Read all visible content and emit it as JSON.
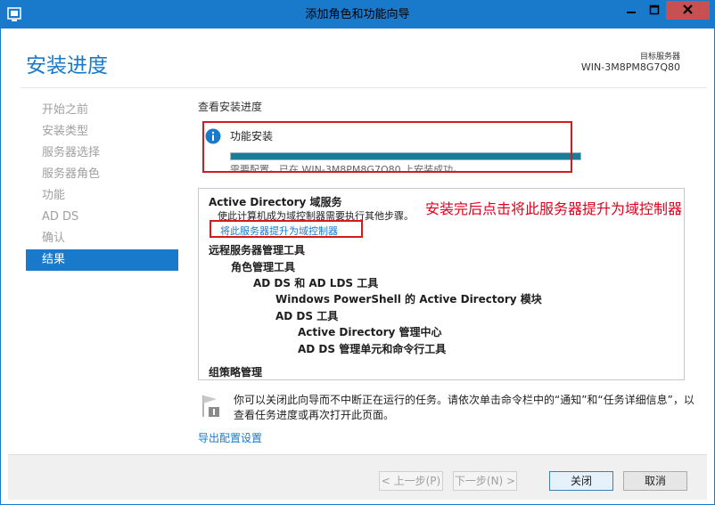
{
  "window": {
    "title": "添加角色和功能向导",
    "controls": {
      "minimize": "minimize-icon",
      "maximize": "maximize-icon",
      "close": "close-icon"
    }
  },
  "header": {
    "page_title": "安装进度",
    "target_label": "目标服务器",
    "target_name": "WIN-3M8PM8G7Q80"
  },
  "nav": {
    "items": [
      {
        "label": "开始之前",
        "active": false
      },
      {
        "label": "安装类型",
        "active": false
      },
      {
        "label": "服务器选择",
        "active": false
      },
      {
        "label": "服务器角色",
        "active": false
      },
      {
        "label": "功能",
        "active": false
      },
      {
        "label": "AD DS",
        "active": false
      },
      {
        "label": "确认",
        "active": false
      },
      {
        "label": "结果",
        "active": true
      }
    ]
  },
  "main": {
    "section_label": "查看安装进度",
    "status": {
      "icon": "info-icon",
      "title": "功能安装",
      "progress_percent": 100,
      "detail": "需要配置。已在 WIN-3M8PM8G7Q80 上安装成功。"
    },
    "results": {
      "ad_heading": "Active Directory 域服务",
      "ad_text": "使此计算机成为域控制器需要执行其他步骤。",
      "promote_link": "将此服务器提升为域控制器",
      "rsat": "远程服务器管理工具",
      "role_tools": "角色管理工具",
      "adds_adlds": "AD DS 和 AD LDS 工具",
      "powershell": "Windows PowerShell 的 Active Directory 模块",
      "adds_tools": "AD DS 工具",
      "ad_admin_center": "Active Directory 管理中心",
      "snapins": "AD DS 管理单元和命令行工具",
      "gpm": "组策略管理"
    },
    "annotation": "安装完后点击将此服务器提升为域控制器",
    "notice": "你可以关闭此向导而不中断正在运行的任务。请依次单击命令栏中的“通知”和“任务详细信息”，以查看任务进度或再次打开此页面。",
    "export_link": "导出配置设置"
  },
  "footer": {
    "prev": "< 上一步(P)",
    "next": "下一步(N) >",
    "close": "关闭",
    "cancel": "取消"
  },
  "colors": {
    "accent": "#1979ca",
    "progress": "#1b7c98",
    "annotation_red": "#e0001b"
  }
}
